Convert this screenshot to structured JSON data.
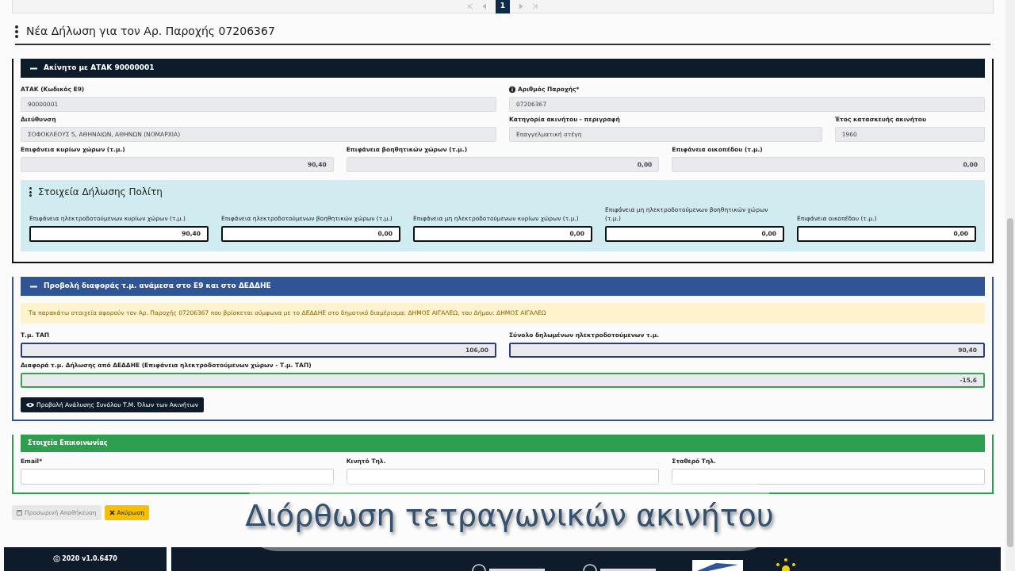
{
  "pagination": {
    "pages": [
      {
        "label": "1",
        "selected": true
      }
    ]
  },
  "title": "Νέα Δήλωση για τον Αρ. Παροχής 07206367",
  "property_section": {
    "header": "Ακίνητο με ΑΤΑΚ 90000001",
    "expanded": true,
    "fields": [
      {
        "label": "ΑΤΑΚ (Κωδικός Ε9)",
        "value": "90000001"
      },
      {
        "label": "Αριθμός Παροχής*",
        "value": "07206367",
        "info": true
      },
      {
        "label": "Διεύθυνση",
        "value": "ΣΟΦΟΚΛΕΟΥΣ  5, ΑΘΗΝΑΙΩΝ, ΑΘΗΝΩΝ (ΝΟΜΑΡΧΙΑ)"
      },
      {
        "label": "Κατηγορία ακινήτου - περιγραφή",
        "value": "Επαγγελματική στέγη"
      },
      {
        "label": "Έτος κατασκευής ακινήτου",
        "value": "1960"
      },
      {
        "label": "Επιφάνεια κυρίων χώρων (τ.μ.)",
        "value": "90,40"
      },
      {
        "label": "Επιφάνεια βοηθητικών χώρων (τ.μ.)",
        "value": "0,00"
      },
      {
        "label": "Επιφάνεια οικοπέδου (τ.μ.)",
        "value": "0,00"
      }
    ],
    "citizen": {
      "title": "Στοιχεία Δήλωσης Πολίτη",
      "fields": [
        {
          "label": "Επιφάνεια ηλεκτροδοτούμενων κυρίων χώρων (τ.μ.)",
          "value": "90,40"
        },
        {
          "label": "Επιφάνεια ηλεκτροδοτούμενων βοηθητικών χώρων (τ.μ.)",
          "value": "0,00"
        },
        {
          "label": "Επιφάνεια μη ηλεκτροδοτούμενων κυρίων χώρων (τ.μ.)",
          "value": "0,00"
        },
        {
          "label": "Επιφάνεια μη ηλεκτροδοτούμενων βοηθητικών χώρων (τ.μ.)",
          "value": "0,00"
        },
        {
          "label": "Επιφάνεια οικοπέδου (τ.μ.)",
          "value": "0,00"
        }
      ]
    }
  },
  "difference_section": {
    "header": "Προβολή διαφοράς τ.μ. ανάμεσα στο Ε9 και στο ΔΕΔΔΗΕ",
    "expanded": true,
    "notice": "Τα παρακάτω στοιχεία αφορούν τον Αρ. Παροχής 07206367 που βρίσκεται σύμφωνα με το ΔΕΔΔΗΕ στο δημοτικό διαμέρισμα: ΔΗΜΟΣ ΑΙΓΑΛΕΩ, του Δήμου: ΔΗΜΟΣ ΑΙΓΑΛΕΩ",
    "fields": [
      {
        "label": "Τ.μ. ΤΑΠ",
        "value": "106,00",
        "color": "#2a3f7a"
      },
      {
        "label": "Σύνολο δηλωμένων ηλεκτροδοτούμενων τ.μ.",
        "value": "90,40",
        "color": "#2a3f7a"
      },
      {
        "label": "Διαφορά τ.μ. Δήλωσης από ΔΕΔΔΗΕ (Επιφάνεια ηλεκτροδοτούμενων χώρων - Τ.μ. ΤΑΠ)",
        "value": "-15,6",
        "color": "#3aa04a"
      }
    ],
    "button": "Προβολή Ανάλυσης Συνόλου Τ.Μ. Όλων των Ακινήτων"
  },
  "contact_section": {
    "header": "Στοιχεία Επικοινωνίας",
    "fields": [
      {
        "label": "Email*"
      },
      {
        "label": "Κινητό Τηλ."
      },
      {
        "label": "Σταθερό Τηλ."
      }
    ]
  },
  "actions": [
    {
      "label": "Προσωρινή Αποθήκευση",
      "kind": "secondary",
      "disabled": true
    },
    {
      "label": "Ακύρωση",
      "kind": "warning",
      "disabled": false
    }
  ],
  "footer": {
    "copyright": "2020 v1.0.6470"
  },
  "caption": "Διόρθωση τετραγωνικών ακινήτου"
}
